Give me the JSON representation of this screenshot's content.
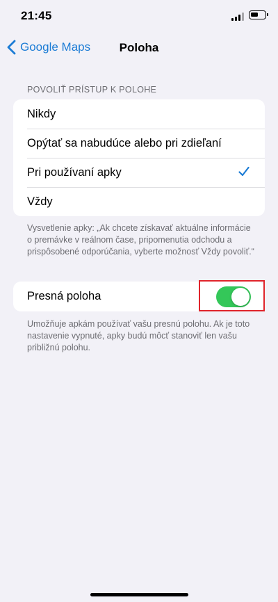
{
  "status_bar": {
    "time": "21:45",
    "battery_level": 0.55
  },
  "nav": {
    "back_label": "Google Maps",
    "title": "Poloha",
    "back_icon": "chevron-left-icon"
  },
  "location_access": {
    "header": "POVOLIŤ PRÍSTUP K POLOHE",
    "options": [
      {
        "label": "Nikdy",
        "selected": false
      },
      {
        "label": "Opýtať sa nabudúce alebo pri zdieľaní",
        "selected": false
      },
      {
        "label": "Pri používaní apky",
        "selected": true
      },
      {
        "label": "Vždy",
        "selected": false
      }
    ],
    "footnote": "Vysvetlenie apky: „Ak chcete získavať aktuálne informácie o premávke v reálnom čase, pripomenutia odchodu a prispôsobené odporúčania, vyberte možnosť Vždy povoliť.“"
  },
  "precise_location": {
    "label": "Presná poloha",
    "enabled": true,
    "footnote": "Umožňuje apkám používať vašu presnú polohu. Ak je toto nastavenie vypnuté, apky budú môcť stanoviť len vašu približnú polohu."
  },
  "colors": {
    "accent": "#1c7cd5",
    "toggle_on": "#34c759",
    "highlight": "#e0242b",
    "background": "#f2f1f7"
  }
}
